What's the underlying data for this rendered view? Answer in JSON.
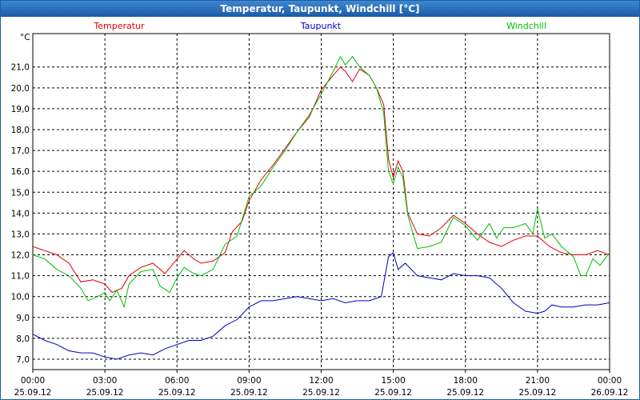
{
  "window": {
    "title": "Temperatur, Taupunkt, Windchill [°C]"
  },
  "chart_data": {
    "type": "line",
    "title": "Temperatur, Taupunkt, Windchill [°C]",
    "ylabel": "°C",
    "ylim": [
      6.5,
      22.6
    ],
    "xlim": [
      0,
      24
    ],
    "grid": true,
    "legend": "top",
    "yticks": [
      "7,0",
      "8,0",
      "9,0",
      "10,0",
      "11,0",
      "12,0",
      "13,0",
      "14,0",
      "15,0",
      "16,0",
      "17,0",
      "18,0",
      "19,0",
      "20,0",
      "21,0"
    ],
    "xticks": [
      {
        "time": "00:00",
        "date": "25.09.12"
      },
      {
        "time": "03:00",
        "date": "25.09.12"
      },
      {
        "time": "06:00",
        "date": "25.09.12"
      },
      {
        "time": "09:00",
        "date": "25.09.12"
      },
      {
        "time": "12:00",
        "date": "25.09.12"
      },
      {
        "time": "15:00",
        "date": "25.09.12"
      },
      {
        "time": "18:00",
        "date": "25.09.12"
      },
      {
        "time": "21:00",
        "date": "25.09.12"
      },
      {
        "time": "00:00",
        "date": "26.09.12"
      }
    ],
    "series": [
      {
        "name": "Temperatur",
        "color": "#e00000",
        "points": [
          [
            0,
            12.4
          ],
          [
            0.5,
            12.2
          ],
          [
            1,
            12.0
          ],
          [
            1.5,
            11.6
          ],
          [
            2,
            10.7
          ],
          [
            2.5,
            10.8
          ],
          [
            3,
            10.6
          ],
          [
            3.3,
            10.2
          ],
          [
            3.7,
            10.4
          ],
          [
            4,
            11.0
          ],
          [
            4.5,
            11.4
          ],
          [
            5,
            11.6
          ],
          [
            5.5,
            11.1
          ],
          [
            6,
            11.8
          ],
          [
            6.3,
            12.2
          ],
          [
            6.7,
            11.8
          ],
          [
            7,
            11.6
          ],
          [
            7.5,
            11.7
          ],
          [
            8,
            12.1
          ],
          [
            8.3,
            13.1
          ],
          [
            8.7,
            13.6
          ],
          [
            9,
            14.6
          ],
          [
            9.5,
            15.6
          ],
          [
            10,
            16.3
          ],
          [
            10.5,
            17.1
          ],
          [
            11,
            17.9
          ],
          [
            11.5,
            18.6
          ],
          [
            12,
            19.9
          ],
          [
            12.5,
            20.6
          ],
          [
            12.8,
            21.0
          ],
          [
            13,
            20.8
          ],
          [
            13.3,
            20.3
          ],
          [
            13.6,
            20.9
          ],
          [
            14,
            20.6
          ],
          [
            14.3,
            20.0
          ],
          [
            14.6,
            19.2
          ],
          [
            14.8,
            16.6
          ],
          [
            15,
            15.7
          ],
          [
            15.2,
            16.5
          ],
          [
            15.4,
            16.0
          ],
          [
            15.6,
            14.0
          ],
          [
            16,
            13.0
          ],
          [
            16.5,
            12.9
          ],
          [
            17,
            13.3
          ],
          [
            17.5,
            13.9
          ],
          [
            18,
            13.5
          ],
          [
            18.5,
            13.0
          ],
          [
            19,
            12.6
          ],
          [
            19.5,
            12.4
          ],
          [
            20,
            12.7
          ],
          [
            20.5,
            12.9
          ],
          [
            21,
            12.9
          ],
          [
            21.5,
            12.4
          ],
          [
            22,
            12.1
          ],
          [
            22.5,
            12.0
          ],
          [
            23,
            12.0
          ],
          [
            23.5,
            12.2
          ],
          [
            24,
            12.0
          ]
        ]
      },
      {
        "name": "Taupunkt",
        "color": "#0000c0",
        "points": [
          [
            0,
            8.2
          ],
          [
            0.5,
            7.9
          ],
          [
            1,
            7.7
          ],
          [
            1.5,
            7.4
          ],
          [
            2,
            7.3
          ],
          [
            2.5,
            7.3
          ],
          [
            3,
            7.1
          ],
          [
            3.5,
            7.0
          ],
          [
            4,
            7.2
          ],
          [
            4.5,
            7.3
          ],
          [
            5,
            7.2
          ],
          [
            5.5,
            7.5
          ],
          [
            6,
            7.7
          ],
          [
            6.5,
            7.9
          ],
          [
            7,
            7.9
          ],
          [
            7.5,
            8.1
          ],
          [
            8,
            8.6
          ],
          [
            8.5,
            8.9
          ],
          [
            9,
            9.5
          ],
          [
            9.5,
            9.8
          ],
          [
            10,
            9.8
          ],
          [
            10.5,
            9.9
          ],
          [
            11,
            10.0
          ],
          [
            11.5,
            9.9
          ],
          [
            12,
            9.8
          ],
          [
            12.5,
            9.9
          ],
          [
            13,
            9.7
          ],
          [
            13.5,
            9.8
          ],
          [
            14,
            9.8
          ],
          [
            14.5,
            10.0
          ],
          [
            14.8,
            11.9
          ],
          [
            15,
            12.1
          ],
          [
            15.2,
            11.3
          ],
          [
            15.5,
            11.6
          ],
          [
            16,
            11.0
          ],
          [
            16.5,
            10.9
          ],
          [
            17,
            10.8
          ],
          [
            17.5,
            11.1
          ],
          [
            18,
            11.0
          ],
          [
            18.5,
            11.0
          ],
          [
            19,
            10.9
          ],
          [
            19.5,
            10.4
          ],
          [
            20,
            9.7
          ],
          [
            20.5,
            9.3
          ],
          [
            21,
            9.2
          ],
          [
            21.3,
            9.3
          ],
          [
            21.6,
            9.6
          ],
          [
            22,
            9.5
          ],
          [
            22.5,
            9.5
          ],
          [
            23,
            9.6
          ],
          [
            23.5,
            9.6
          ],
          [
            24,
            9.7
          ]
        ]
      },
      {
        "name": "Windchill",
        "color": "#00c000",
        "points": [
          [
            0,
            12.0
          ],
          [
            0.5,
            11.8
          ],
          [
            1,
            11.3
          ],
          [
            1.5,
            11.0
          ],
          [
            2,
            10.4
          ],
          [
            2.3,
            9.8
          ],
          [
            2.7,
            10.0
          ],
          [
            3,
            10.2
          ],
          [
            3.2,
            9.8
          ],
          [
            3.5,
            10.3
          ],
          [
            3.8,
            9.5
          ],
          [
            4,
            10.6
          ],
          [
            4.5,
            11.2
          ],
          [
            5,
            11.3
          ],
          [
            5.3,
            10.5
          ],
          [
            5.7,
            10.2
          ],
          [
            6,
            10.9
          ],
          [
            6.3,
            11.4
          ],
          [
            6.7,
            11.1
          ],
          [
            7,
            11.0
          ],
          [
            7.5,
            11.3
          ],
          [
            8,
            12.5
          ],
          [
            8.5,
            12.9
          ],
          [
            9,
            14.8
          ],
          [
            9.5,
            15.3
          ],
          [
            10,
            16.2
          ],
          [
            10.5,
            17.0
          ],
          [
            11,
            17.9
          ],
          [
            11.5,
            18.7
          ],
          [
            12,
            19.7
          ],
          [
            12.5,
            20.8
          ],
          [
            12.8,
            21.5
          ],
          [
            13,
            21.1
          ],
          [
            13.3,
            21.5
          ],
          [
            13.6,
            21.0
          ],
          [
            14,
            20.6
          ],
          [
            14.3,
            20.0
          ],
          [
            14.6,
            18.8
          ],
          [
            14.8,
            16.0
          ],
          [
            15,
            15.4
          ],
          [
            15.2,
            16.2
          ],
          [
            15.4,
            15.7
          ],
          [
            15.6,
            13.9
          ],
          [
            16,
            12.3
          ],
          [
            16.5,
            12.4
          ],
          [
            17,
            12.6
          ],
          [
            17.5,
            13.8
          ],
          [
            18,
            13.4
          ],
          [
            18.5,
            12.7
          ],
          [
            19,
            13.5
          ],
          [
            19.3,
            12.8
          ],
          [
            19.6,
            13.3
          ],
          [
            20,
            13.3
          ],
          [
            20.5,
            13.5
          ],
          [
            20.8,
            13.0
          ],
          [
            21,
            14.2
          ],
          [
            21.3,
            12.8
          ],
          [
            21.6,
            13.0
          ],
          [
            22,
            12.4
          ],
          [
            22.5,
            11.9
          ],
          [
            22.8,
            11.0
          ],
          [
            23,
            11.0
          ],
          [
            23.3,
            11.8
          ],
          [
            23.6,
            11.5
          ],
          [
            24,
            12.1
          ]
        ]
      }
    ]
  }
}
